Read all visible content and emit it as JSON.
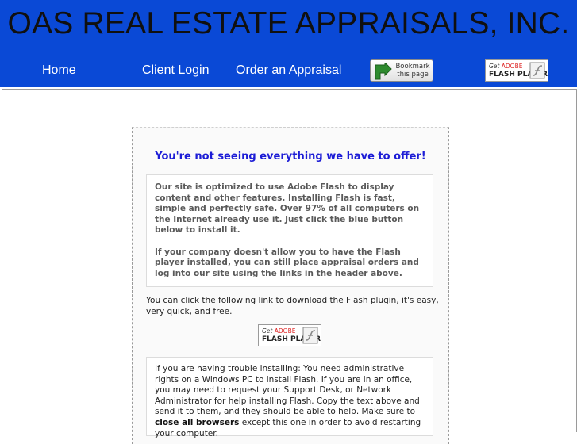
{
  "header": {
    "title": "OAS REAL ESTATE APPRAISALS, INC.",
    "nav": [
      "Home",
      "Client Login",
      "Order an Appraisal"
    ],
    "bookmark": {
      "line1": "Bookmark",
      "line2": "this page",
      "icon": "bookmark-arrow-icon"
    },
    "flash_badge": {
      "get": "Get",
      "adobe": "ADOBE",
      "player": "FLASH PLAYER",
      "icon": "flash-logo-icon"
    }
  },
  "colors": {
    "header_bg": "#0a49d6",
    "headline": "#1c1cd6"
  },
  "main": {
    "headline": "You're not seeing everything we have to offer!",
    "notice_p1": "Our site is optimized to use Adobe Flash to display content and other features. Installing Flash is fast, simple and perfectly safe. Over 97% of all computers on the Internet already use it. Just click the blue button below to install it.",
    "notice_p2": "If your company doesn't allow you to have the Flash player installed, you can still place appraisal orders and log into our site using the links in the header above.",
    "download_text": "You can click the following link to download the Flash plugin, it's easy, very quick, and free.",
    "trouble": {
      "part1": "If you are having trouble installing: You need administrative rights on a Windows PC to install Flash. If you are in an office, you may need to request your Support Desk, or Network Administrator for help installing Flash. Copy the text above and send it to them, and they should be able to help. Make sure to ",
      "bold": "close all browsers",
      "part2": " except this one in order to avoid restarting your computer."
    }
  }
}
